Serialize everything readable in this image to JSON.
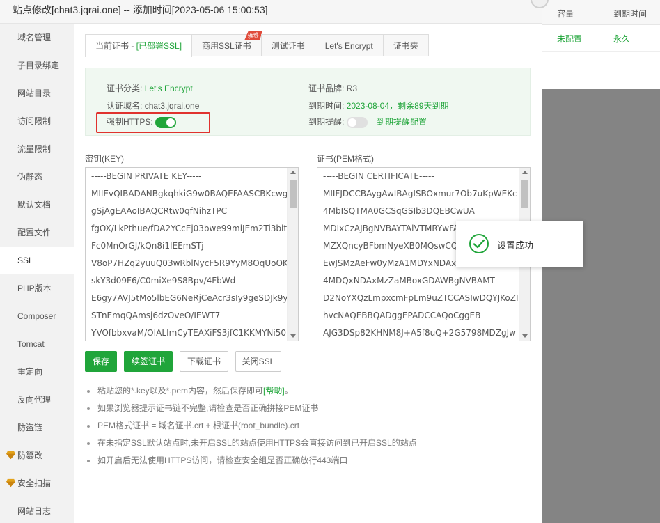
{
  "window": {
    "title": "站点修改[chat3.jqrai.one] -- 添加时间[2023-05-06 15:00:53]"
  },
  "background_table": {
    "headers": [
      "容量",
      "到期时间"
    ],
    "row": [
      "未配置",
      "永久"
    ]
  },
  "sidebar": {
    "items": [
      {
        "label": "域名管理"
      },
      {
        "label": "子目录绑定"
      },
      {
        "label": "网站目录"
      },
      {
        "label": "访问限制"
      },
      {
        "label": "流量限制"
      },
      {
        "label": "伪静态"
      },
      {
        "label": "默认文档"
      },
      {
        "label": "配置文件"
      },
      {
        "label": "SSL"
      },
      {
        "label": "PHP版本"
      },
      {
        "label": "Composer"
      },
      {
        "label": "Tomcat"
      },
      {
        "label": "重定向"
      },
      {
        "label": "反向代理"
      },
      {
        "label": "防盗链"
      },
      {
        "label": "防篡改"
      },
      {
        "label": "安全扫描"
      },
      {
        "label": "网站日志"
      }
    ],
    "active_index": 8
  },
  "tabs": [
    {
      "label": "当前证书 - ",
      "suffix": "[已部署SSL]"
    },
    {
      "label": "商用SSL证书",
      "badge": "推荐"
    },
    {
      "label": "测试证书"
    },
    {
      "label": "Let's Encrypt"
    },
    {
      "label": "证书夹"
    }
  ],
  "cert_info": {
    "category_label": "证书分类:",
    "category_value": "Let's Encrypt",
    "domain_label": "认证域名:",
    "domain_value": "chat3.jqrai.one",
    "force_https_label": "强制HTTPS:",
    "force_https_on": true,
    "brand_label": "证书品牌:",
    "brand_value": "R3",
    "expire_label": "到期时间:",
    "expire_value": "2023-08-04，剩余89天到期",
    "remind_label": "到期提醒:",
    "remind_on": false,
    "remind_link": "到期提醒配置",
    "accent": "#20a53a"
  },
  "key_field": {
    "label": "密钥(KEY)",
    "lines": [
      "-----BEGIN PRIVATE KEY-----",
      "MIIEvQIBADANBgkqhkiG9w0BAQEFAASCBKcwg",
      "gSjAgEAAoIBAQCRtw0qfNihzTPC",
      "fgOX/LkPthue/fDA2YCcEj03bwe99miJEm2Ti3bit",
      "Fc0MnOrGJ/kQn8i1IEEmSTj",
      "V8oP7HZq2yuuQ03wRblNycF5R9YyM8OqUoOK",
      "skY3d09F6/C0miXe9S8Bpv/4FbWd",
      "E6gy7AVJ5tMo5lbEG6NeRjCeAcr3sIy9geSDJk9y",
      "STnEmqQAmsj6dzOveO/IEWT7",
      "YVOfbbxvaM/OIALImCyTEAXiFS3jfC1KKMYNi50"
    ]
  },
  "cert_field": {
    "label": "证书(PEM格式)",
    "lines": [
      "-----BEGIN CERTIFICATE-----",
      "MIIFJDCCBAygAwIBAgISBOxmur7Ob7uKpWEKc",
      "4MbISQTMA0GCSqGSIb3DQEBCwUA",
      "MDIxCzAJBgNVBAYTAlVTMRYwFA",
      "MZXQncyBFbmNyeXB0MQswCQY",
      "EwJSMzAeFw0yMzA1MDYxNDAxM",
      "4MDQxNDAxMzZaMBoxGDAWBgNVBAMT",
      "D2NoYXQzLmpxcmFpLm9uZTCCASIwDQYJKoZI",
      "hvcNAQEBBQADggEPADCCAQoCggEB",
      "AJG3DSp82KHNM8J+A5f8uQ+2G5798MDZgJw"
    ]
  },
  "buttons": {
    "save": "保存",
    "renew": "续签证书",
    "download": "下载证书",
    "close_ssl": "关闭SSL"
  },
  "notes": [
    {
      "text": "粘贴您的*.key以及*.pem内容，然后保存即可",
      "link": "[帮助]",
      "tail": "。"
    },
    {
      "text": "如果浏览器提示证书链不完整,请检查是否正确拼接PEM证书"
    },
    {
      "text": "PEM格式证书 = 域名证书.crt + 根证书(root_bundle).crt"
    },
    {
      "text": "在未指定SSL默认站点时,未开启SSL的站点使用HTTPS会直接访问到已开启SSL的站点"
    },
    {
      "text": "如开启后无法使用HTTPS访问，请检查安全组是否正确放行443端口"
    }
  ],
  "toast": {
    "message": "设置成功",
    "icon": "check-circle-icon"
  }
}
